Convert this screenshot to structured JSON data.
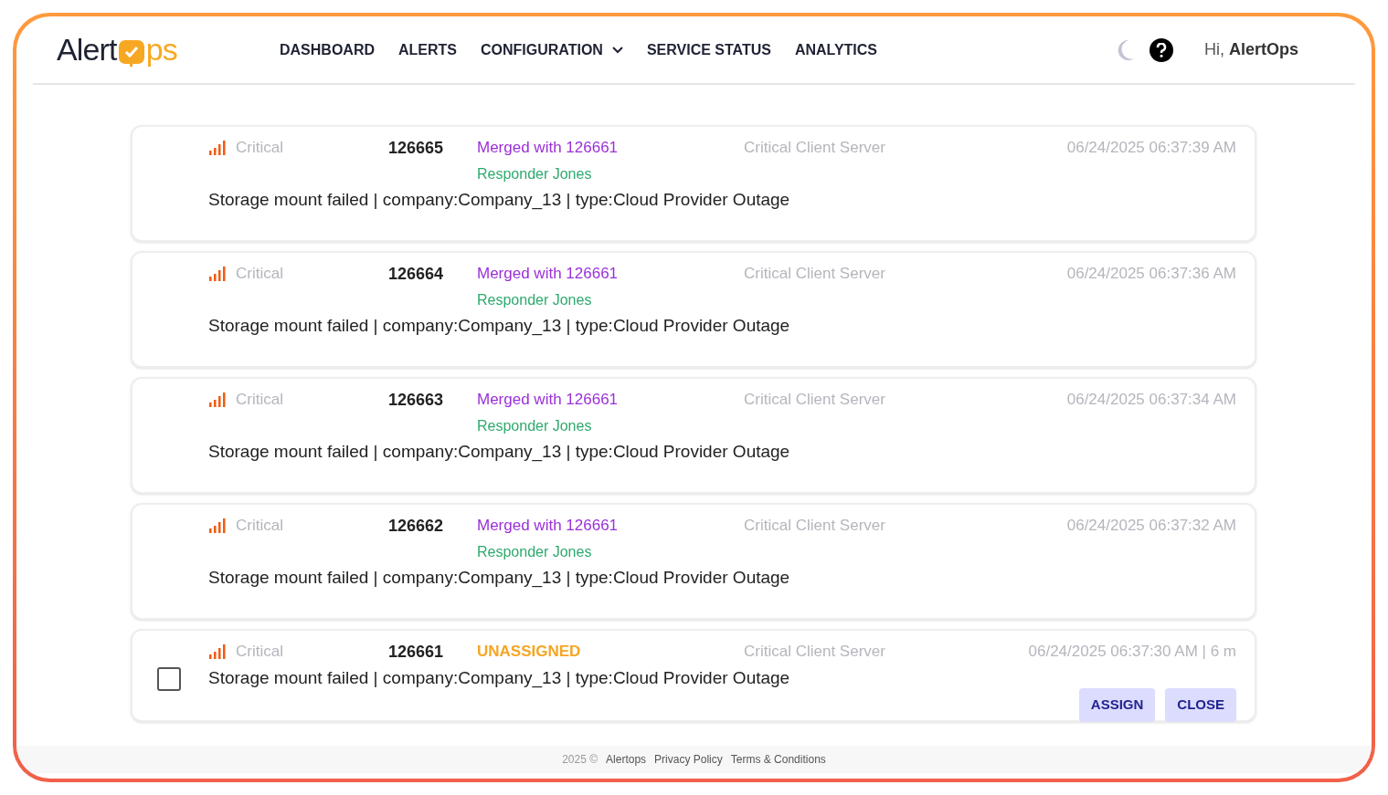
{
  "header": {
    "logo": {
      "left": "Alert",
      "right": "ps"
    },
    "nav": [
      {
        "label": "DASHBOARD",
        "dropdown": false
      },
      {
        "label": "ALERTS",
        "dropdown": false
      },
      {
        "label": "CONFIGURATION",
        "dropdown": true
      },
      {
        "label": "SERVICE STATUS",
        "dropdown": false
      },
      {
        "label": "ANALYTICS",
        "dropdown": false
      }
    ],
    "greeting": "Hi,",
    "user": "AlertOps"
  },
  "alerts": [
    {
      "kind": "merged",
      "severity": "Critical",
      "id": "126665",
      "status": "Merged with 126661",
      "responder": "Responder Jones",
      "service": "Critical Client Server",
      "time": "06/24/2025 06:37:39 AM",
      "description": "Storage mount failed | company:Company_13 | type:Cloud Provider Outage"
    },
    {
      "kind": "merged",
      "severity": "Critical",
      "id": "126664",
      "status": "Merged with 126661",
      "responder": "Responder Jones",
      "service": "Critical Client Server",
      "time": "06/24/2025 06:37:36 AM",
      "description": "Storage mount failed | company:Company_13 | type:Cloud Provider Outage"
    },
    {
      "kind": "merged",
      "severity": "Critical",
      "id": "126663",
      "status": "Merged with 126661",
      "responder": "Responder Jones",
      "service": "Critical Client Server",
      "time": "06/24/2025 06:37:34 AM",
      "description": "Storage mount failed | company:Company_13 | type:Cloud Provider Outage"
    },
    {
      "kind": "merged",
      "severity": "Critical",
      "id": "126662",
      "status": "Merged with 126661",
      "responder": "Responder Jones",
      "service": "Critical Client Server",
      "time": "06/24/2025 06:37:32 AM",
      "description": "Storage mount failed | company:Company_13 | type:Cloud Provider Outage"
    },
    {
      "kind": "unassigned",
      "severity": "Critical",
      "id": "126661",
      "status": "UNASSIGNED",
      "service": "Critical Client Server",
      "time": "06/24/2025 06:37:30 AM | 6 m",
      "description": "Storage mount failed | company:Company_13 | type:Cloud Provider Outage",
      "checked": false,
      "buttons": [
        "ASSIGN",
        "CLOSE"
      ]
    }
  ],
  "footer": {
    "copyright": "2025 ©",
    "links": [
      "Alertops",
      "Privacy Policy",
      "Terms & Conditions"
    ]
  }
}
